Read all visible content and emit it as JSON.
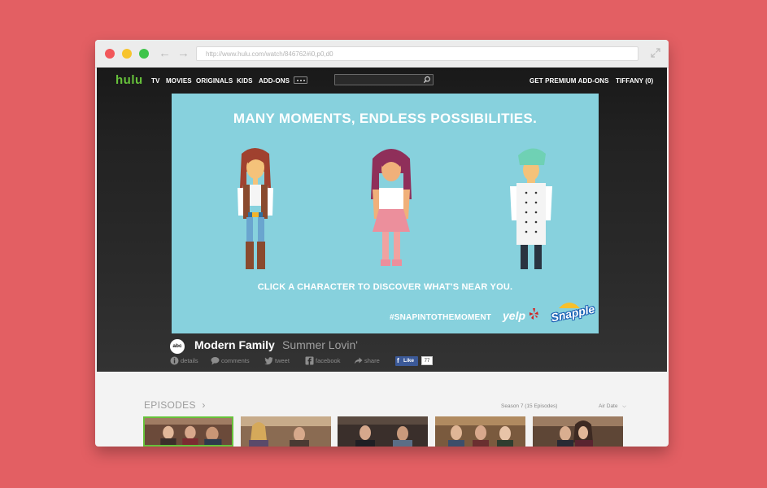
{
  "browser": {
    "url": "http://www.hulu.com/watch/846762#i0,p0,d0",
    "icons": [
      "close-dot",
      "minimize-dot",
      "maximize-dot",
      "back-arrow",
      "forward-arrow",
      "expand-icon"
    ]
  },
  "nav": {
    "logo": "hulu",
    "items": [
      "TV",
      "MOVIES",
      "ORIGINALS",
      "KIDS",
      "ADD-ONS"
    ],
    "more_label": "more",
    "search_placeholder": "",
    "premium": "GET PREMIUM ADD-ONS",
    "account": "TIFFANY (0)"
  },
  "ad": {
    "headline": "MANY MOMENTS, ENDLESS POSSIBILITIES.",
    "subline": "CLICK A CHARACTER TO DISCOVER WHAT'S NEAR YOU.",
    "hashtag": "#SNAPINTOTHEMOMENT",
    "sponsor_1": "yelp",
    "sponsor_2": "Snapple",
    "colors": {
      "background": "#87d1dd",
      "text": "#ffffff"
    }
  },
  "show": {
    "network": "abc",
    "title": "Modern Family",
    "episode": "Summer Lovin'",
    "actions": [
      "details",
      "comments",
      "tweet",
      "facebook",
      "share"
    ],
    "fb_like": "Like",
    "fb_count": "77"
  },
  "episodes": {
    "label": "EPISODES",
    "season": "Season 7 (15 Episodes)",
    "sort": "Air Date"
  },
  "colors": {
    "accent": "#67c23b",
    "page_bg": "#e35f63",
    "facebook": "#3b5998"
  }
}
